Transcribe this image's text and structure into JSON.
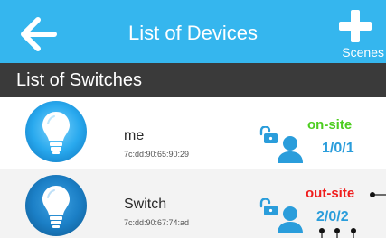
{
  "navbar": {
    "title": "List of Devices",
    "back_icon": "arrow-left-icon",
    "scenes_icon": "plus-icon",
    "scenes_label": "Scenes"
  },
  "section": {
    "title": "List of Switches"
  },
  "devices": [
    {
      "name": "me",
      "mac": "7c:dd:90:65:90:29",
      "site_status": "on-site",
      "counts": "1/0/1",
      "icon": "lightbulb-icon"
    },
    {
      "name": "Switch",
      "mac": "7c:dd:90:67:74:ad",
      "site_status": "out-site",
      "counts": "2/0/2",
      "icon": "lightbulb-icon"
    }
  ],
  "colors": {
    "navbar": "#35b6ee",
    "section_header": "#3a3a3a",
    "on_site": "#4ccd1f",
    "out_site": "#f01d1d",
    "counts": "#2a9ddb"
  }
}
